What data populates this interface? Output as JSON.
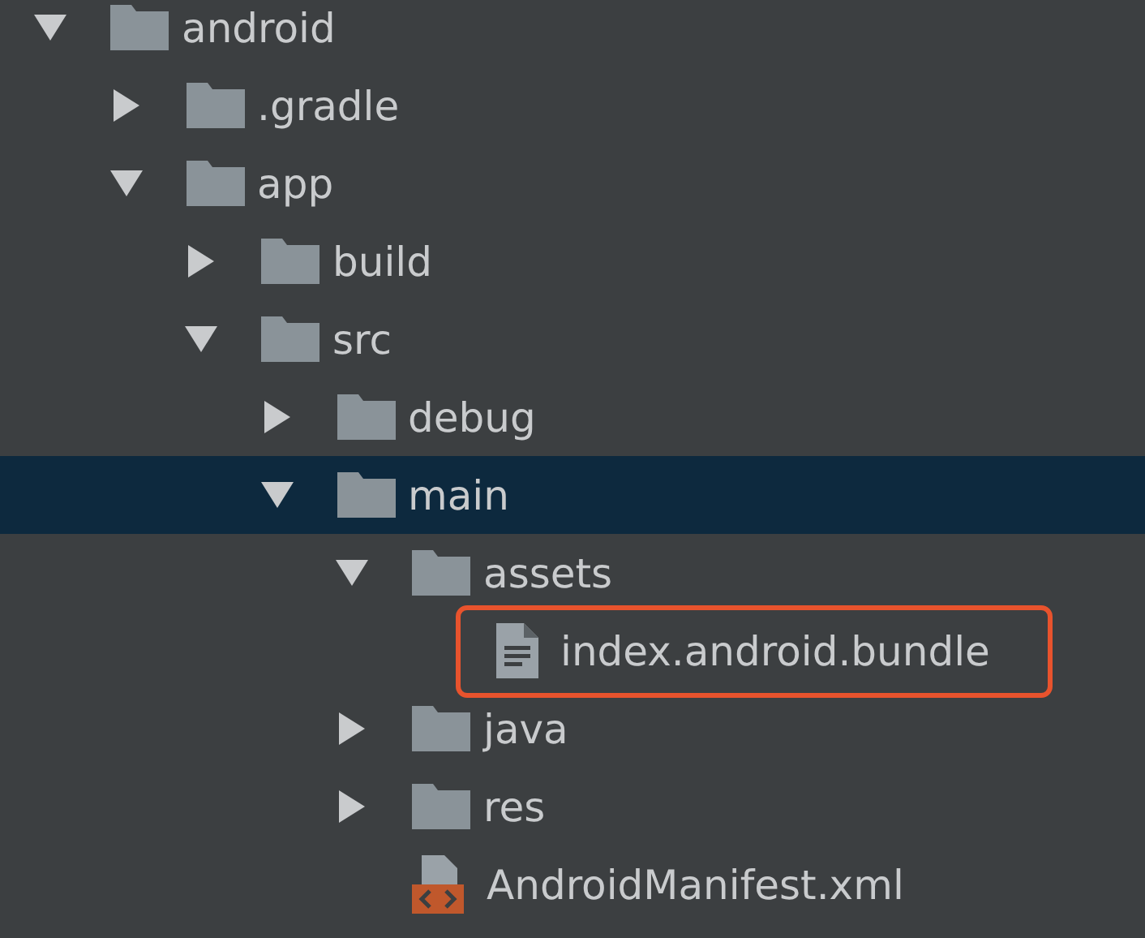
{
  "tree": [
    {
      "label": "android",
      "kind": "folder",
      "expanded": true,
      "selected": false,
      "highlighted": false,
      "children": [
        {
          "label": ".gradle",
          "kind": "folder",
          "expanded": false,
          "selected": false,
          "highlighted": false
        },
        {
          "label": "app",
          "kind": "folder",
          "expanded": true,
          "selected": false,
          "highlighted": false,
          "children": [
            {
              "label": "build",
              "kind": "folder",
              "expanded": false,
              "selected": false,
              "highlighted": false
            },
            {
              "label": "src",
              "kind": "folder",
              "expanded": true,
              "selected": false,
              "highlighted": false,
              "children": [
                {
                  "label": "debug",
                  "kind": "folder",
                  "expanded": false,
                  "selected": false,
                  "highlighted": false
                },
                {
                  "label": "main",
                  "kind": "folder",
                  "expanded": true,
                  "selected": true,
                  "highlighted": false,
                  "children": [
                    {
                      "label": "assets",
                      "kind": "folder",
                      "expanded": true,
                      "selected": false,
                      "highlighted": false,
                      "children": [
                        {
                          "label": "index.android.bundle",
                          "kind": "file",
                          "selected": false,
                          "highlighted": true
                        }
                      ]
                    },
                    {
                      "label": "java",
                      "kind": "folder",
                      "expanded": false,
                      "selected": false,
                      "highlighted": false
                    },
                    {
                      "label": "res",
                      "kind": "folder",
                      "expanded": false,
                      "selected": false,
                      "highlighted": false
                    },
                    {
                      "label": "AndroidManifest.xml",
                      "kind": "manifest",
                      "selected": false,
                      "highlighted": false
                    }
                  ]
                }
              ]
            }
          ]
        }
      ]
    }
  ]
}
